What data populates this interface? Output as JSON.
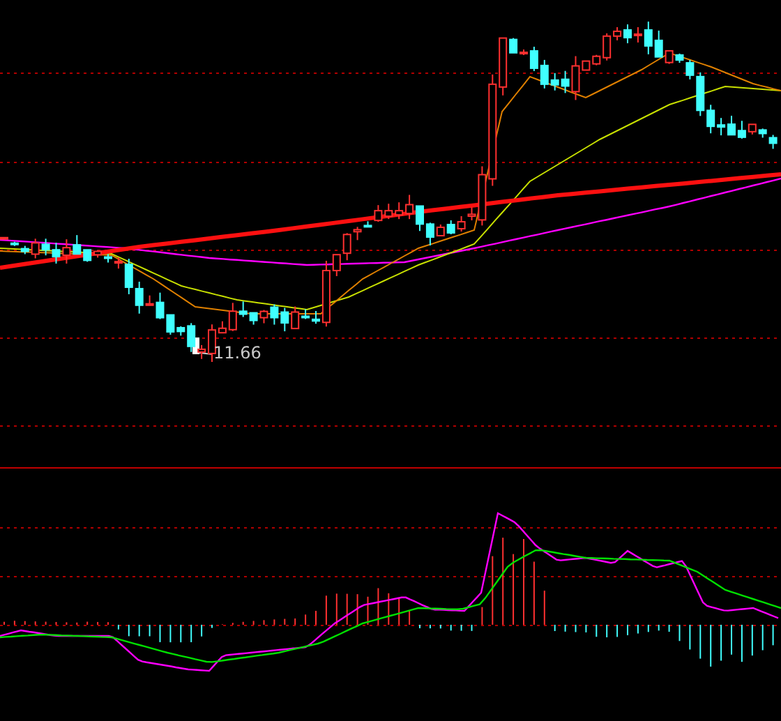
{
  "chart": {
    "low_price_label": "11.66"
  }
}
